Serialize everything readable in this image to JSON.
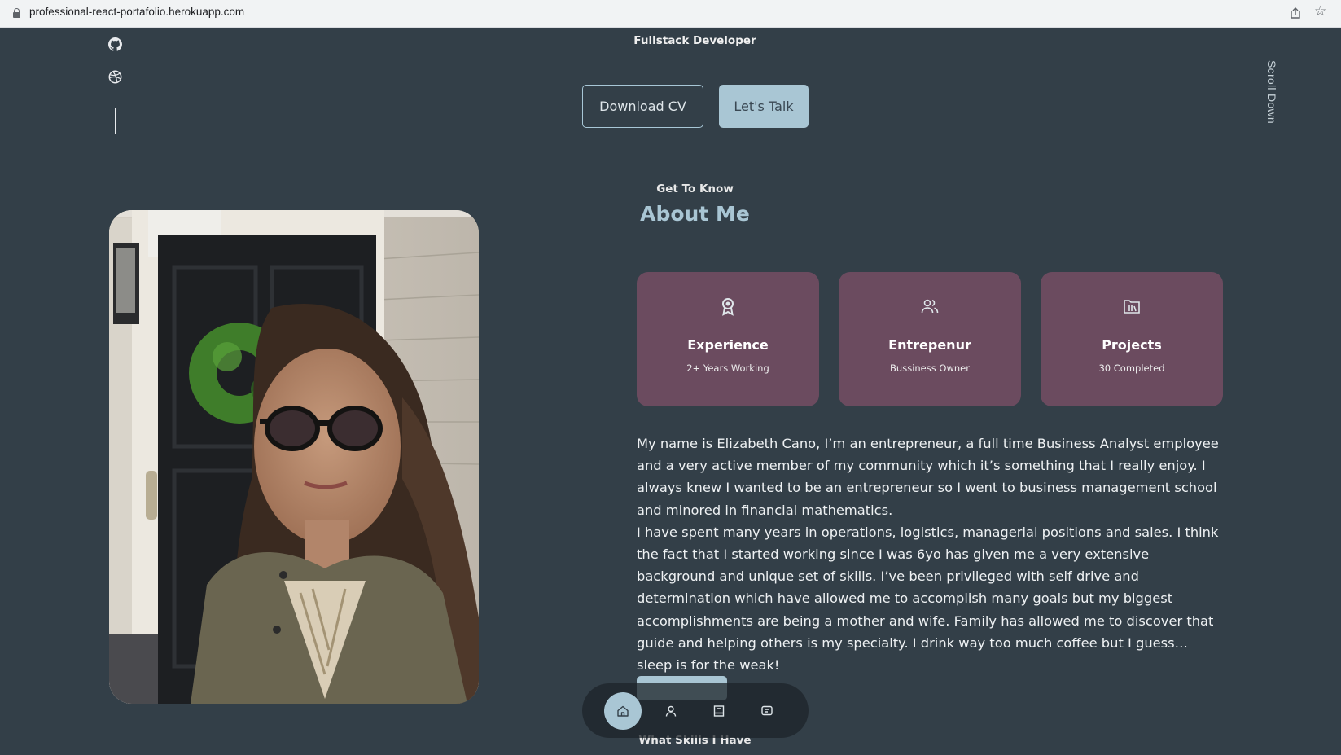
{
  "browser": {
    "url": "professional-react-portafolio.herokuapp.com"
  },
  "header": {
    "subtitle": "Fullstack Developer",
    "download_cv_label": "Download CV",
    "lets_talk_label": "Let's Talk",
    "scroll_down_label": "Scroll Down"
  },
  "socials": {
    "items": [
      {
        "name": "github",
        "icon": "github-icon"
      },
      {
        "name": "dribbble",
        "icon": "dribbble-icon"
      }
    ]
  },
  "about": {
    "subtitle": "Get To Know",
    "title": "About Me",
    "cards": [
      {
        "title": "Experience",
        "desc": "2+ Years Working",
        "icon": "award-icon"
      },
      {
        "title": "Entrepenur",
        "desc": "Bussiness Owner",
        "icon": "users-icon"
      },
      {
        "title": "Projects",
        "desc": "30 Completed",
        "icon": "folder-icon"
      }
    ],
    "bio_p1": "My name is Elizabeth Cano, I’m an entrepreneur, a full time Business Analyst employee and a very active member of my community which it’s something that I really enjoy. I always knew I wanted to be an entrepreneur so I went to business management school and minored in financial mathematics.",
    "bio_p2": "I have spent many years in operations, logistics, managerial positions and sales. I think the fact that I started working since I was 6yo has given me a very extensive background and unique set of skills. I’ve been privileged with self drive and determination which have allowed me to accomplish many goals but my biggest accomplishments are being a mother and wife. Family has allowed me to discover that guide and helping others is my specialty. I drink way too much coffee but I guess… sleep is for the weak!"
  },
  "skills": {
    "subtitle": "What Skills I Have"
  },
  "nav": {
    "items": [
      {
        "name": "home",
        "icon": "home-icon",
        "active": true
      },
      {
        "name": "about",
        "icon": "user-icon",
        "active": false
      },
      {
        "name": "experience",
        "icon": "book-icon",
        "active": false
      },
      {
        "name": "contact",
        "icon": "message-icon",
        "active": false
      }
    ]
  },
  "colors": {
    "background": "#333f48",
    "accent": "#a9c6d4",
    "card": "#6b4b5f"
  }
}
